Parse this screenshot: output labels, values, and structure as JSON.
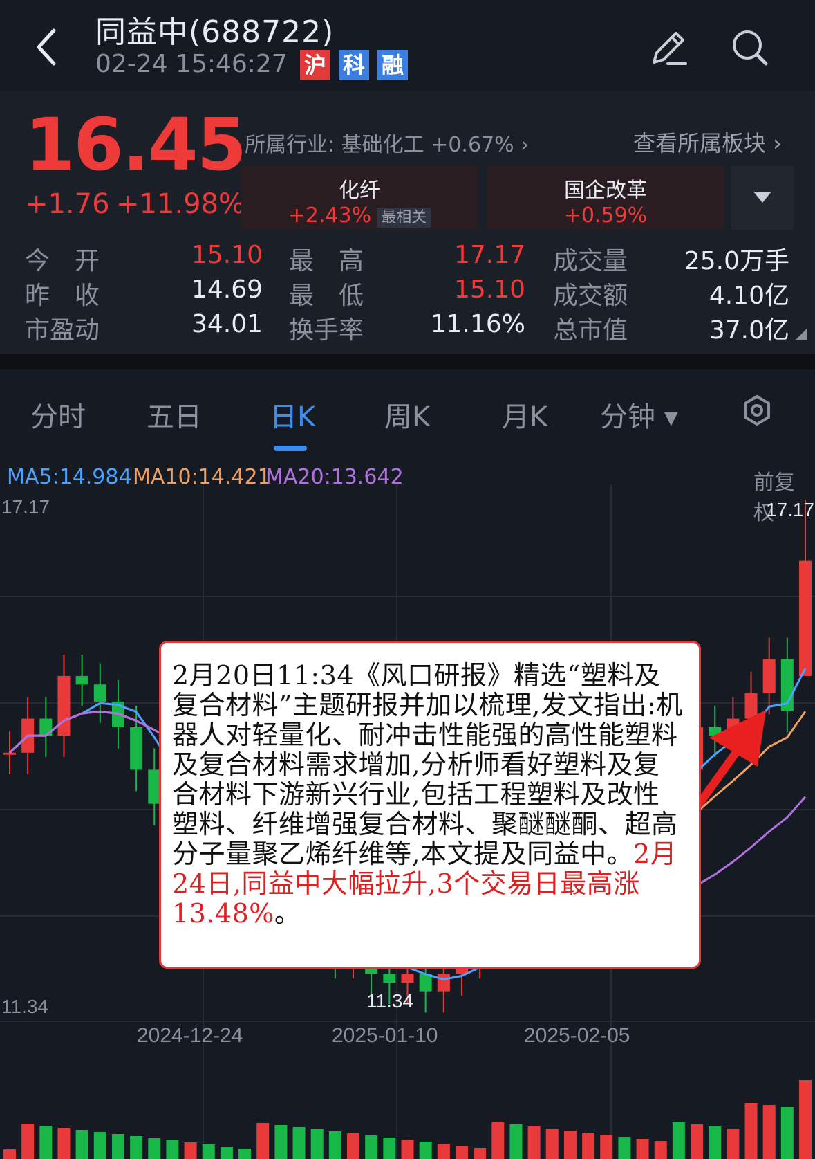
{
  "header": {
    "title": "同益中(688722)",
    "datetime": "02-24 15:46:27",
    "tags": [
      "沪",
      "科",
      "融"
    ]
  },
  "quote": {
    "price": "16.45",
    "change": "+1.76",
    "change_pct": "+11.98%",
    "industry": "所属行业: 基础化工 +0.67% ›",
    "view_blocks": "查看所属板块 ›",
    "concepts": [
      {
        "name": "化纤",
        "value": "+2.43%",
        "badge": "最相关"
      },
      {
        "name": "国企改革",
        "value": "+0.59%"
      }
    ],
    "stats": [
      {
        "label": "今　开",
        "value": "15.10"
      },
      {
        "label": "最　高",
        "value": "17.17"
      },
      {
        "label": "成交量",
        "value": "25.0万手"
      },
      {
        "label": "昨　收",
        "value": "14.69"
      },
      {
        "label": "最　低",
        "value": "15.10"
      },
      {
        "label": "成交额",
        "value": "4.10亿"
      },
      {
        "label": "市盈动",
        "value": "34.01"
      },
      {
        "label": "换手率",
        "value": "11.16%"
      },
      {
        "label": "总市值",
        "value": "37.0亿"
      }
    ]
  },
  "tabs": [
    "分时",
    "五日",
    "日K",
    "周K",
    "月K",
    "分钟 ▾"
  ],
  "chart_data": {
    "type": "candlestick",
    "ma": [
      {
        "name": "MA5",
        "value": "MA5:14.984",
        "color": "#4aa3ff"
      },
      {
        "name": "MA10",
        "value": "MA10:14.421",
        "color": "#f0a060"
      },
      {
        "name": "MA20",
        "value": "MA20:13.642",
        "color": "#b070e0"
      }
    ],
    "adjust_label": "前复权",
    "y_max_label": "17.17",
    "y_min_label": "11.34",
    "high_label": "17.17",
    "low_label": "11.34",
    "x_labels": [
      "2024-12-24",
      "2025-01-10",
      "2025-02-05"
    ],
    "ylim": [
      11.34,
      17.17
    ]
  },
  "note": {
    "text": "2月20日11:34《风口研报》精选“塑料及复合材料”主题研报并加以梳理,发文指出:机器人对轻量化、耐冲击性能强的高性能塑料及复合材料需求增加,分析师看好塑料及复合材料下游新兴行业,包括工程塑料及改性塑料、纤维增强复合材料、聚醚醚酮、超高分子量聚乙烯纤维等,本文提及同益中。",
    "highlight": "2月24日,同益中大幅拉升,3个交易日最高涨13.48%",
    "end": "。"
  }
}
